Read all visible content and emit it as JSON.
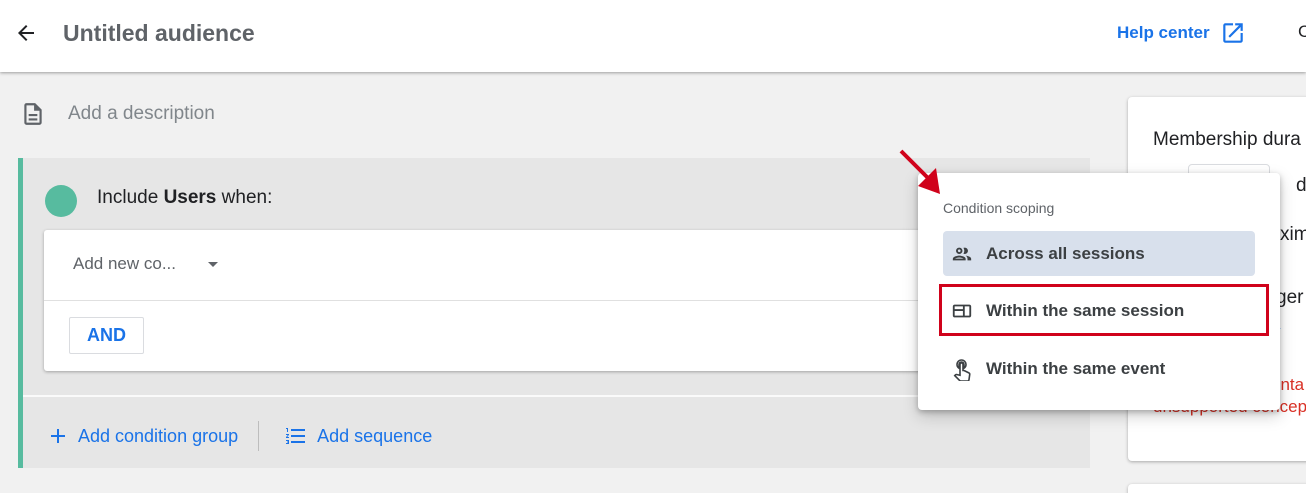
{
  "header": {
    "title": "Untitled audience",
    "help_label": "Help center",
    "cut_letter": "C"
  },
  "description": {
    "placeholder": "Add a description"
  },
  "group": {
    "include_prefix": "Include",
    "include_subject": "Users",
    "include_suffix": "when:",
    "condition_placeholder": "Add new co...",
    "and_label": "AND",
    "add_condition_group_label": "Add condition group",
    "add_sequence_label": "Add sequence",
    "accent_color": "#57bb9f"
  },
  "sidepanel": {
    "title": "Membership dura",
    "frag_days": "day",
    "frag_max": "xim",
    "frag_trigger": "ger",
    "frag_link": "v",
    "warning_line1": "onta",
    "warning_line2": "unsupported concep"
  },
  "menu": {
    "heading": "Condition scoping",
    "items": [
      {
        "label": "Across all sessions",
        "icon": "people-icon",
        "selected": true
      },
      {
        "label": "Within the same session",
        "icon": "session-icon",
        "selected": false
      },
      {
        "label": "Within the same event",
        "icon": "touch-icon",
        "selected": false
      }
    ]
  },
  "colors": {
    "link_blue": "#1a73e8",
    "annotation_red": "#d0021b",
    "selected_bg": "#d8e0ec"
  }
}
